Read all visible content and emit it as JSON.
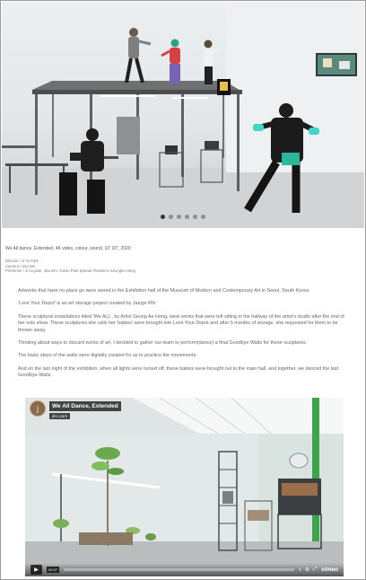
{
  "hero": {
    "slides_total": 6,
    "active_slide": 1
  },
  "work": {
    "title_line": "We All dance, Extended, 4K video, colour, sound, 10' 10\", 2020",
    "credits": [
      "Director / Ji ho Park",
      "Camera / Jisu kim",
      "Performer / Ji ho park, Jisu kim, Yumin Park Special Thanks to Seungho Hong"
    ]
  },
  "body": {
    "paragraphs": [
      "Artworks that have no place go were stored in the Exhibition hall of the Museum of Modern and Contemporary Art in Seoul, South Korea",
      "'Love Your Depot' is an art storage project created by Jaeyje Rhi",
      "These sculptural installations titled 'We ALL', by Artist Seung Ae Hong, were works that were left sitting in the hallway of the artist's studio after the end of her solo show. These sculptures she calls her 'babies' were brought into Love Your Depot and after 5 months of storage, she requested for them to be thrown away.",
      "Thinking about ways to discard works of art, I decided to gather our team to perform(dance) a final Goodbye Waltz for these sculptures.",
      "The basic steps of the waltz were digitally created for us to practice the movements.",
      "And on the last night of the exhibition, when all lights were turned off, these babies were brought out to the main hall, and together, we danced the last Goodbye Waltz."
    ]
  },
  "video": {
    "avatar_letter": "j",
    "title": "We All Dance, Extended",
    "author": "jiho park",
    "time": "09:37",
    "logo": "vimeo",
    "icons": [
      "play-icon",
      "volume-icon",
      "settings-icon",
      "fullscreen-icon"
    ]
  }
}
